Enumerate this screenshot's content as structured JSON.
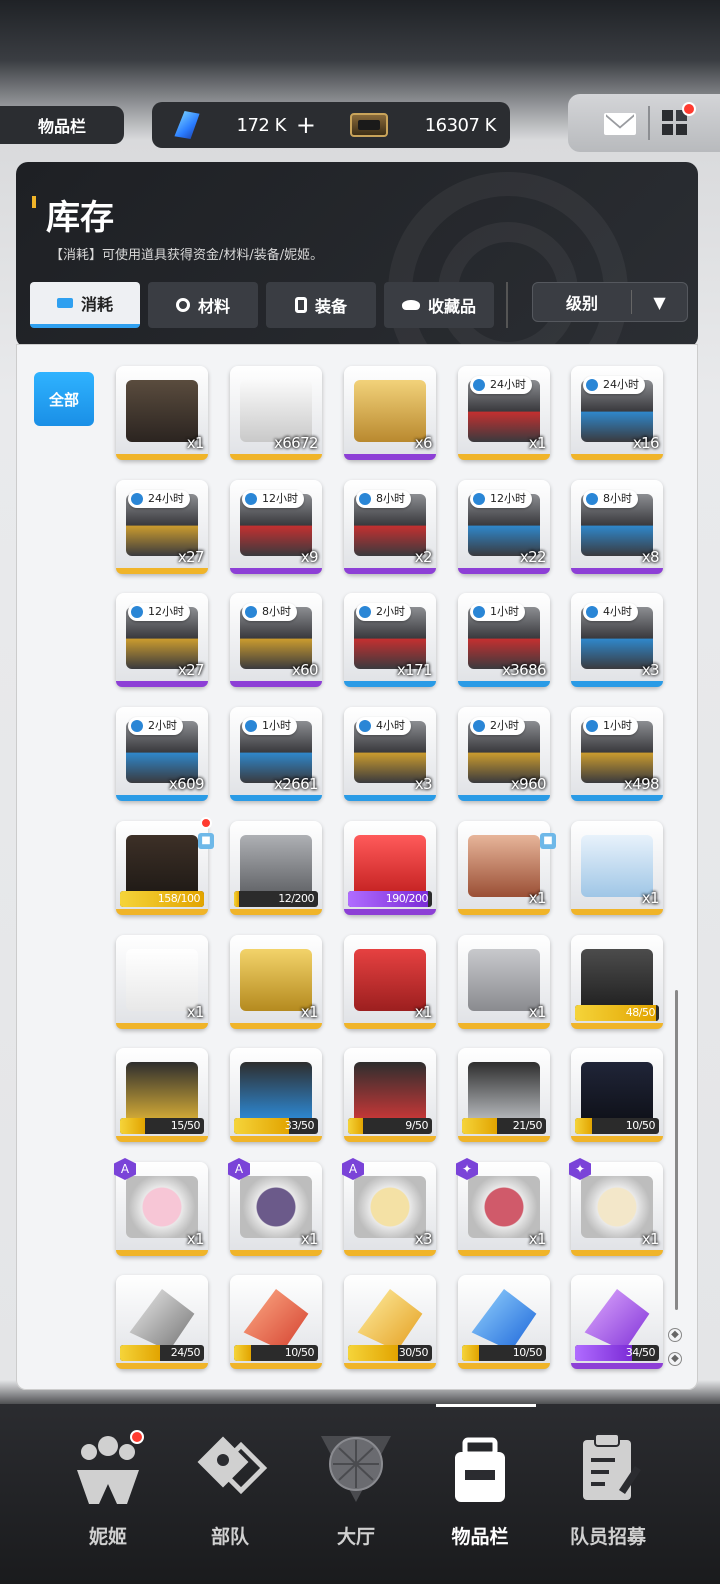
{
  "header": {
    "screen_label": "物品栏",
    "currency_gem": "172 K",
    "currency_gem_add": "+",
    "currency_ticket": "16307 K"
  },
  "panel": {
    "title": "库存",
    "description": "【消耗】可使用道具获得资金/材料/装备/妮姬。",
    "tabs": [
      {
        "label": "消耗",
        "active": true
      },
      {
        "label": "材料",
        "active": false
      },
      {
        "label": "装备",
        "active": false
      },
      {
        "label": "收藏品",
        "active": false
      }
    ],
    "sort_label": "级别",
    "sort_arrow": "▼",
    "filter_all": "全部"
  },
  "items": [
    {
      "count": "x1",
      "rarity": "gold",
      "art": "crate-dark"
    },
    {
      "count": "x6672",
      "rarity": "gold",
      "art": "crate-white"
    },
    {
      "count": "x6",
      "rarity": "purple",
      "art": "box-gold"
    },
    {
      "timer": "24小时",
      "count": "x1",
      "rarity": "gold",
      "art": "case-red"
    },
    {
      "timer": "24小时",
      "count": "x16",
      "rarity": "gold",
      "art": "case-blue"
    },
    {
      "timer": "24小时",
      "count": "x27",
      "rarity": "gold",
      "art": "case-gold"
    },
    {
      "timer": "12小时",
      "count": "x9",
      "rarity": "purple",
      "art": "case-red"
    },
    {
      "timer": "8小时",
      "count": "x2",
      "rarity": "purple",
      "art": "case-red"
    },
    {
      "timer": "12小时",
      "count": "x22",
      "rarity": "purple",
      "art": "case-blue"
    },
    {
      "timer": "8小时",
      "count": "x8",
      "rarity": "purple",
      "art": "case-blue"
    },
    {
      "timer": "12小时",
      "count": "x27",
      "rarity": "purple",
      "art": "case-gold"
    },
    {
      "timer": "8小时",
      "count": "x60",
      "rarity": "purple",
      "art": "case-gold"
    },
    {
      "timer": "2小时",
      "count": "x171",
      "rarity": "blue",
      "art": "case-red"
    },
    {
      "timer": "1小时",
      "count": "x3686",
      "rarity": "blue",
      "art": "case-red"
    },
    {
      "timer": "4小时",
      "count": "x3",
      "rarity": "blue",
      "art": "case-blue"
    },
    {
      "timer": "2小时",
      "count": "x609",
      "rarity": "blue",
      "art": "case-blue"
    },
    {
      "timer": "1小时",
      "count": "x2661",
      "rarity": "blue",
      "art": "case-blue"
    },
    {
      "timer": "4小时",
      "count": "x3",
      "rarity": "blue",
      "art": "case-gold"
    },
    {
      "timer": "2小时",
      "count": "x960",
      "rarity": "blue",
      "art": "case-gold"
    },
    {
      "timer": "1小时",
      "count": "x498",
      "rarity": "blue",
      "art": "case-gold"
    },
    {
      "progress": "158/100",
      "fill": 1.0,
      "rarity": "gold",
      "art": "chest-gold",
      "dot": true,
      "lock": true
    },
    {
      "progress": "12/200",
      "fill": 0.06,
      "rarity": "gold",
      "art": "crate-grey"
    },
    {
      "progress": "190/200",
      "fill": 0.95,
      "rarity": "purple",
      "art": "lucky-box"
    },
    {
      "count": "x1",
      "rarity": "gold",
      "art": "cake",
      "lock": true
    },
    {
      "count": "x1",
      "rarity": "gold",
      "art": "keychain"
    },
    {
      "count": "x1",
      "rarity": "gold",
      "art": "drawing"
    },
    {
      "count": "x1",
      "rarity": "gold",
      "art": "can"
    },
    {
      "count": "x1",
      "rarity": "gold",
      "art": "book-red"
    },
    {
      "count": "x1",
      "rarity": "gold",
      "art": "figure"
    },
    {
      "progress": "48/50",
      "fill": 0.96,
      "rarity": "gold",
      "art": "folder-dark"
    },
    {
      "progress": "15/50",
      "fill": 0.3,
      "rarity": "gold",
      "art": "folder-gold"
    },
    {
      "progress": "33/50",
      "fill": 0.66,
      "rarity": "gold",
      "art": "folder-blue"
    },
    {
      "progress": "9/50",
      "fill": 0.18,
      "rarity": "gold",
      "art": "folder-red"
    },
    {
      "progress": "21/50",
      "fill": 0.42,
      "rarity": "gold",
      "art": "folder-silver"
    },
    {
      "progress": "10/50",
      "fill": 0.2,
      "rarity": "gold",
      "art": "folder-navy"
    },
    {
      "count": "x1",
      "rarity": "gold",
      "art": "portrait-pink",
      "badge": "A"
    },
    {
      "count": "x1",
      "rarity": "gold",
      "art": "portrait-dark",
      "badge": "A"
    },
    {
      "count": "x3",
      "rarity": "gold",
      "art": "portrait-blonde",
      "badge": "A"
    },
    {
      "count": "x1",
      "rarity": "gold",
      "art": "portrait-red",
      "badge": "✦"
    },
    {
      "count": "x1",
      "rarity": "gold",
      "art": "portrait-white",
      "badge": "✦"
    },
    {
      "progress": "24/50",
      "fill": 0.48,
      "rarity": "gold",
      "art": "shard-silver"
    },
    {
      "progress": "10/50",
      "fill": 0.2,
      "rarity": "gold",
      "art": "shard-red"
    },
    {
      "progress": "30/50",
      "fill": 0.6,
      "rarity": "gold",
      "art": "shard-gold"
    },
    {
      "progress": "10/50",
      "fill": 0.2,
      "rarity": "gold",
      "art": "shard-blue"
    },
    {
      "progress": "34/50",
      "fill": 0.68,
      "rarity": "purple",
      "art": "shard-purple"
    }
  ],
  "nav": [
    {
      "label": "妮姬",
      "icon": "nikke-icon",
      "dot": true
    },
    {
      "label": "部队",
      "icon": "squad-icon"
    },
    {
      "label": "大厅",
      "icon": "lobby-icon"
    },
    {
      "label": "物品栏",
      "icon": "inventory-icon",
      "active": true
    },
    {
      "label": "队员招募",
      "icon": "recruit-icon"
    }
  ],
  "colors": {
    "rarity_gold": "#f0b429",
    "rarity_purple": "#8d3fd6",
    "rarity_blue": "#2a9be6",
    "accent": "#2fa0f0",
    "badge": "#ff3b30"
  }
}
